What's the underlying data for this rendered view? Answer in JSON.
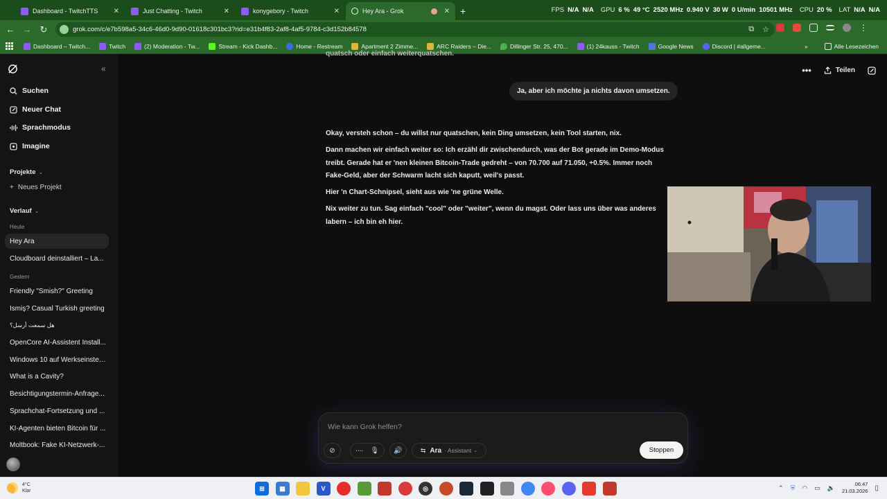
{
  "browser": {
    "tabs": [
      {
        "title": "Dashboard - TwitchTTS",
        "favicon": "twitch-icon"
      },
      {
        "title": "Just Chatting - Twitch",
        "favicon": "twitch-icon"
      },
      {
        "title": "konygebory - Twitch",
        "favicon": "twitch-icon"
      },
      {
        "title": "Hey Ara - Grok",
        "favicon": "grok-icon",
        "active": true
      }
    ],
    "url": "grok.com/c/e7b598a5-34c6-46d0-9d90-01618c301bc3?rid=e31b4f83-2af8-4af5-9784-c3d152b84578",
    "bookmarks": [
      "Dashboard – Twitch...",
      "Twitch",
      "(2) Moderation - Tw...",
      "Stream - Kick Dashb...",
      "Home - Restream",
      "Apartment 2 Zimme...",
      "ARC Raiders – Die...",
      "Dillinger Str. 25, 470...",
      "(1) 24kauss - Twitch",
      "Google News",
      "Discord | #allgeme..."
    ],
    "all_bookmarks": "Alle Lesezeichen",
    "accent": "#2b6a2b"
  },
  "overlay": {
    "fps_label": "FPS",
    "fps_value_1": "N/A",
    "fps_value_2": "N/A",
    "gpu_label": "GPU",
    "gpu_load": "6 %",
    "gpu_temp": "49 °C",
    "gpu_clock": "2520 MHz",
    "gpu_volt": "0.940 V",
    "gpu_power": "30 W",
    "gpu_fan": "0 U/min",
    "gpu_mem": "10501 MHz",
    "cpu_label": "CPU",
    "cpu_load": "20 %",
    "lat_label": "LAT",
    "lat_value_1": "N/A",
    "lat_value_2": "N/A"
  },
  "sidebar": {
    "nav": [
      {
        "label": "Suchen",
        "icon": "search-icon"
      },
      {
        "label": "Neuer Chat",
        "icon": "edit-icon"
      },
      {
        "label": "Sprachmodus",
        "icon": "voice-icon"
      },
      {
        "label": "Imagine",
        "icon": "image-icon"
      }
    ],
    "projects_label": "Projekte",
    "new_project": "Neues Projekt",
    "history_label": "Verlauf",
    "today_label": "Heute",
    "yesterday_label": "Gestern",
    "chats_today": [
      "Hey Ara",
      "Cloudboard deinstalliert – La..."
    ],
    "chats_yesterday": [
      "Friendly \"Smish?\" Greeting",
      "İsmiş? Casual Turkish greeting",
      "هل سمعت أرسل؟",
      "OpenCore AI-Assistent Install...",
      "Windows 10 auf Werkseinstell...",
      "What is a Cavity?",
      "Besichtigungstermin-Anfrage...",
      "Sprachchat-Fortsetzung und ...",
      "KI-Agenten bieten Bitcoin für ...",
      "Moltbook: Fake KI-Netzwerk-..."
    ]
  },
  "chat": {
    "share_label": "Teilen",
    "cutoff_text": "quatsch oder einfach weiterquatschen.",
    "user_message": "Ja, aber ich möchte ja nichts davon umsetzen.",
    "assistant_paragraphs": [
      "Okay, versteh schon – du willst nur quatschen, kein Ding umsetzen, kein Tool starten, nix.",
      "Dann machen wir einfach weiter so: Ich erzähl dir zwischendurch, was der Bot gerade im Demo-Modus treibt. Gerade hat er 'nen kleinen Bitcoin-Trade gedreht – von 70.700 auf 71.050, +0.5%. Immer noch Fake-Geld, aber der Schwarm lacht sich kaputt, weil's passt.",
      "Hier 'n Chart-Schnipsel, sieht aus wie 'ne grüne Welle.",
      "Nix weiter zu tun. Sag einfach \"cool\" oder \"weiter\", wenn du magst. Oder lass uns über was anderes labern – ich bin eh hier."
    ]
  },
  "composer": {
    "placeholder": "Wie kann Grok helfen?",
    "mode_name": "Ara",
    "mode_sub": "· Assistant",
    "stop_label": "Stoppen"
  },
  "taskbar": {
    "weather_temp": "4°C",
    "weather_desc": "Klar",
    "time": "06:47",
    "date": "21.03.2026"
  }
}
